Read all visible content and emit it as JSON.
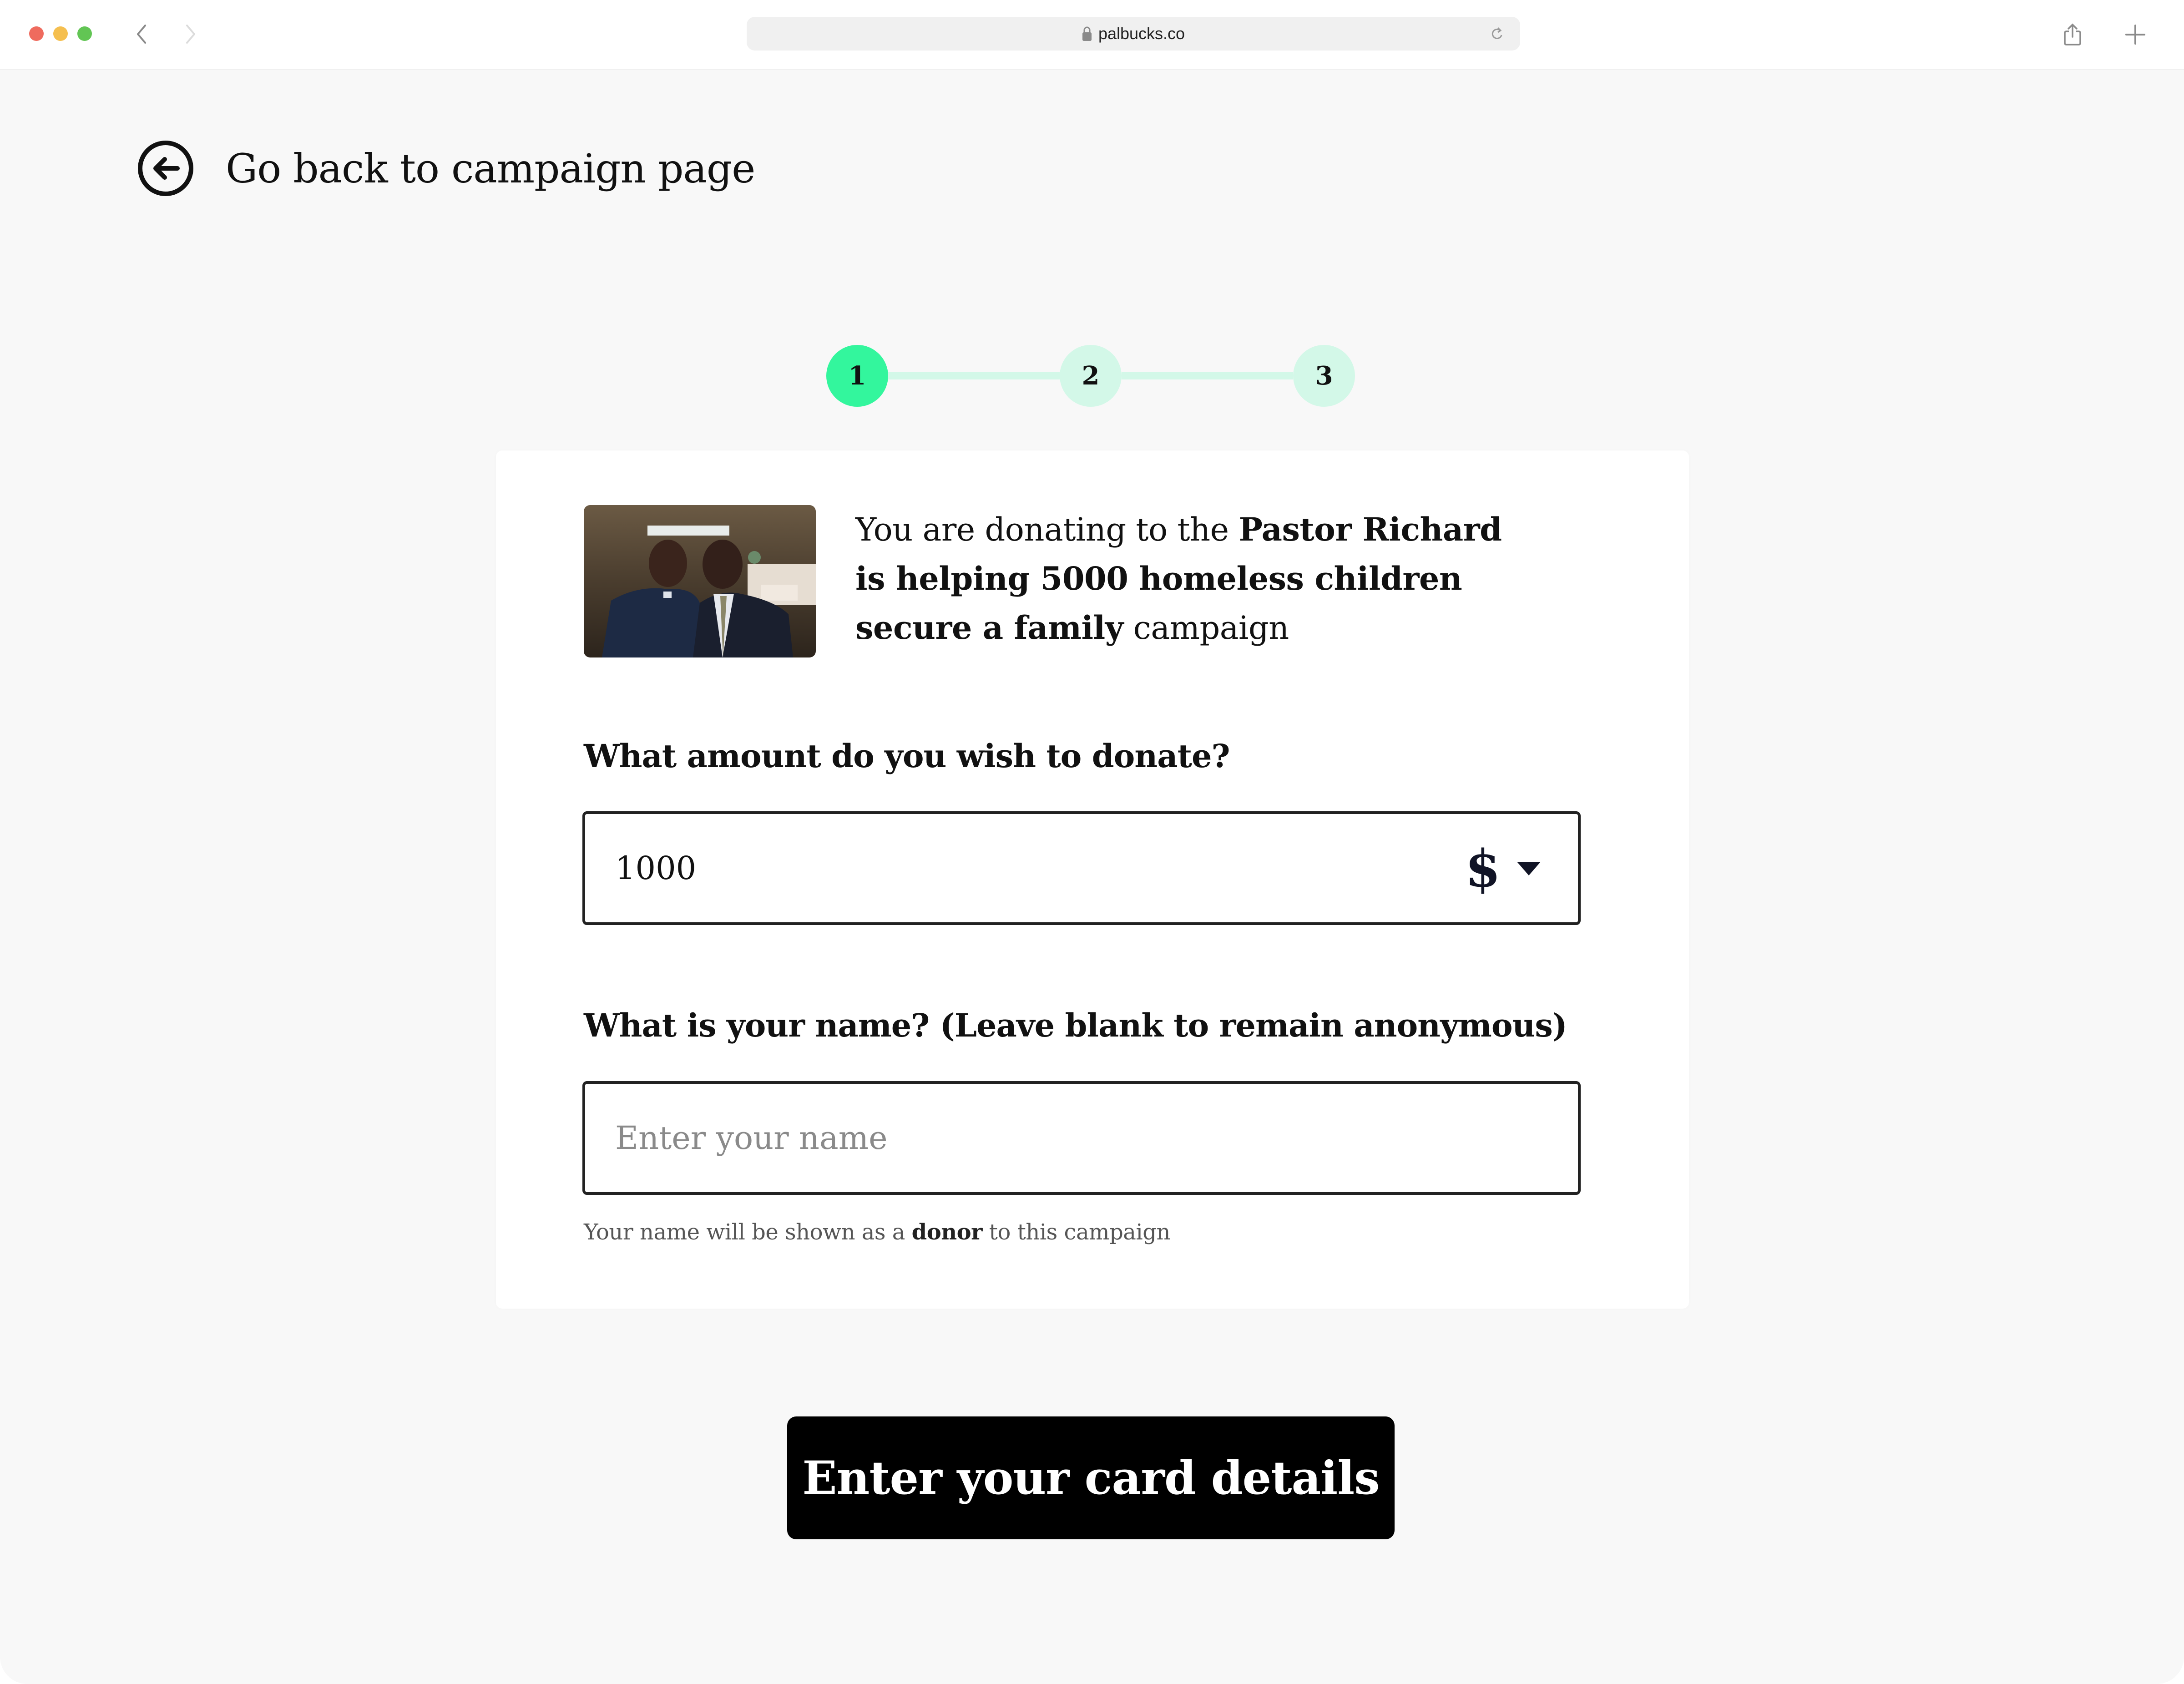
{
  "browser": {
    "url": "palbucks.co",
    "icons": {
      "back": "chevron-left-icon",
      "forward": "chevron-right-icon",
      "lock": "lock-icon",
      "reload": "reload-icon",
      "share": "share-icon",
      "new_tab": "plus-icon"
    }
  },
  "back_link": {
    "label": "Go back to campaign page",
    "icon": "arrow-left-circle-icon"
  },
  "stepper": {
    "current_step": 1,
    "steps": [
      {
        "label": "1",
        "state": "active"
      },
      {
        "label": "2",
        "state": "pending"
      },
      {
        "label": "3",
        "state": "pending"
      }
    ],
    "colors": {
      "active": "#33f69d",
      "pending": "#d3f8e8"
    }
  },
  "campaign": {
    "image_alt": "Two men in suits smiling",
    "intro": "You are donating to the ",
    "name": "Pastor Richard is helping 5000 homeless children secure a family",
    "suffix": " campaign"
  },
  "amount_field": {
    "label": "What amount do you wish to donate?",
    "value": "1000",
    "currency": "$"
  },
  "name_field": {
    "label": "What is your name? (Leave blank to remain anonymous)",
    "value": "",
    "placeholder": "Enter your name"
  },
  "helper": {
    "prefix": "Your name will be shown as a ",
    "emphasis": "donor",
    "suffix": " to this campaign"
  },
  "cta": {
    "label": "Enter your card details"
  }
}
